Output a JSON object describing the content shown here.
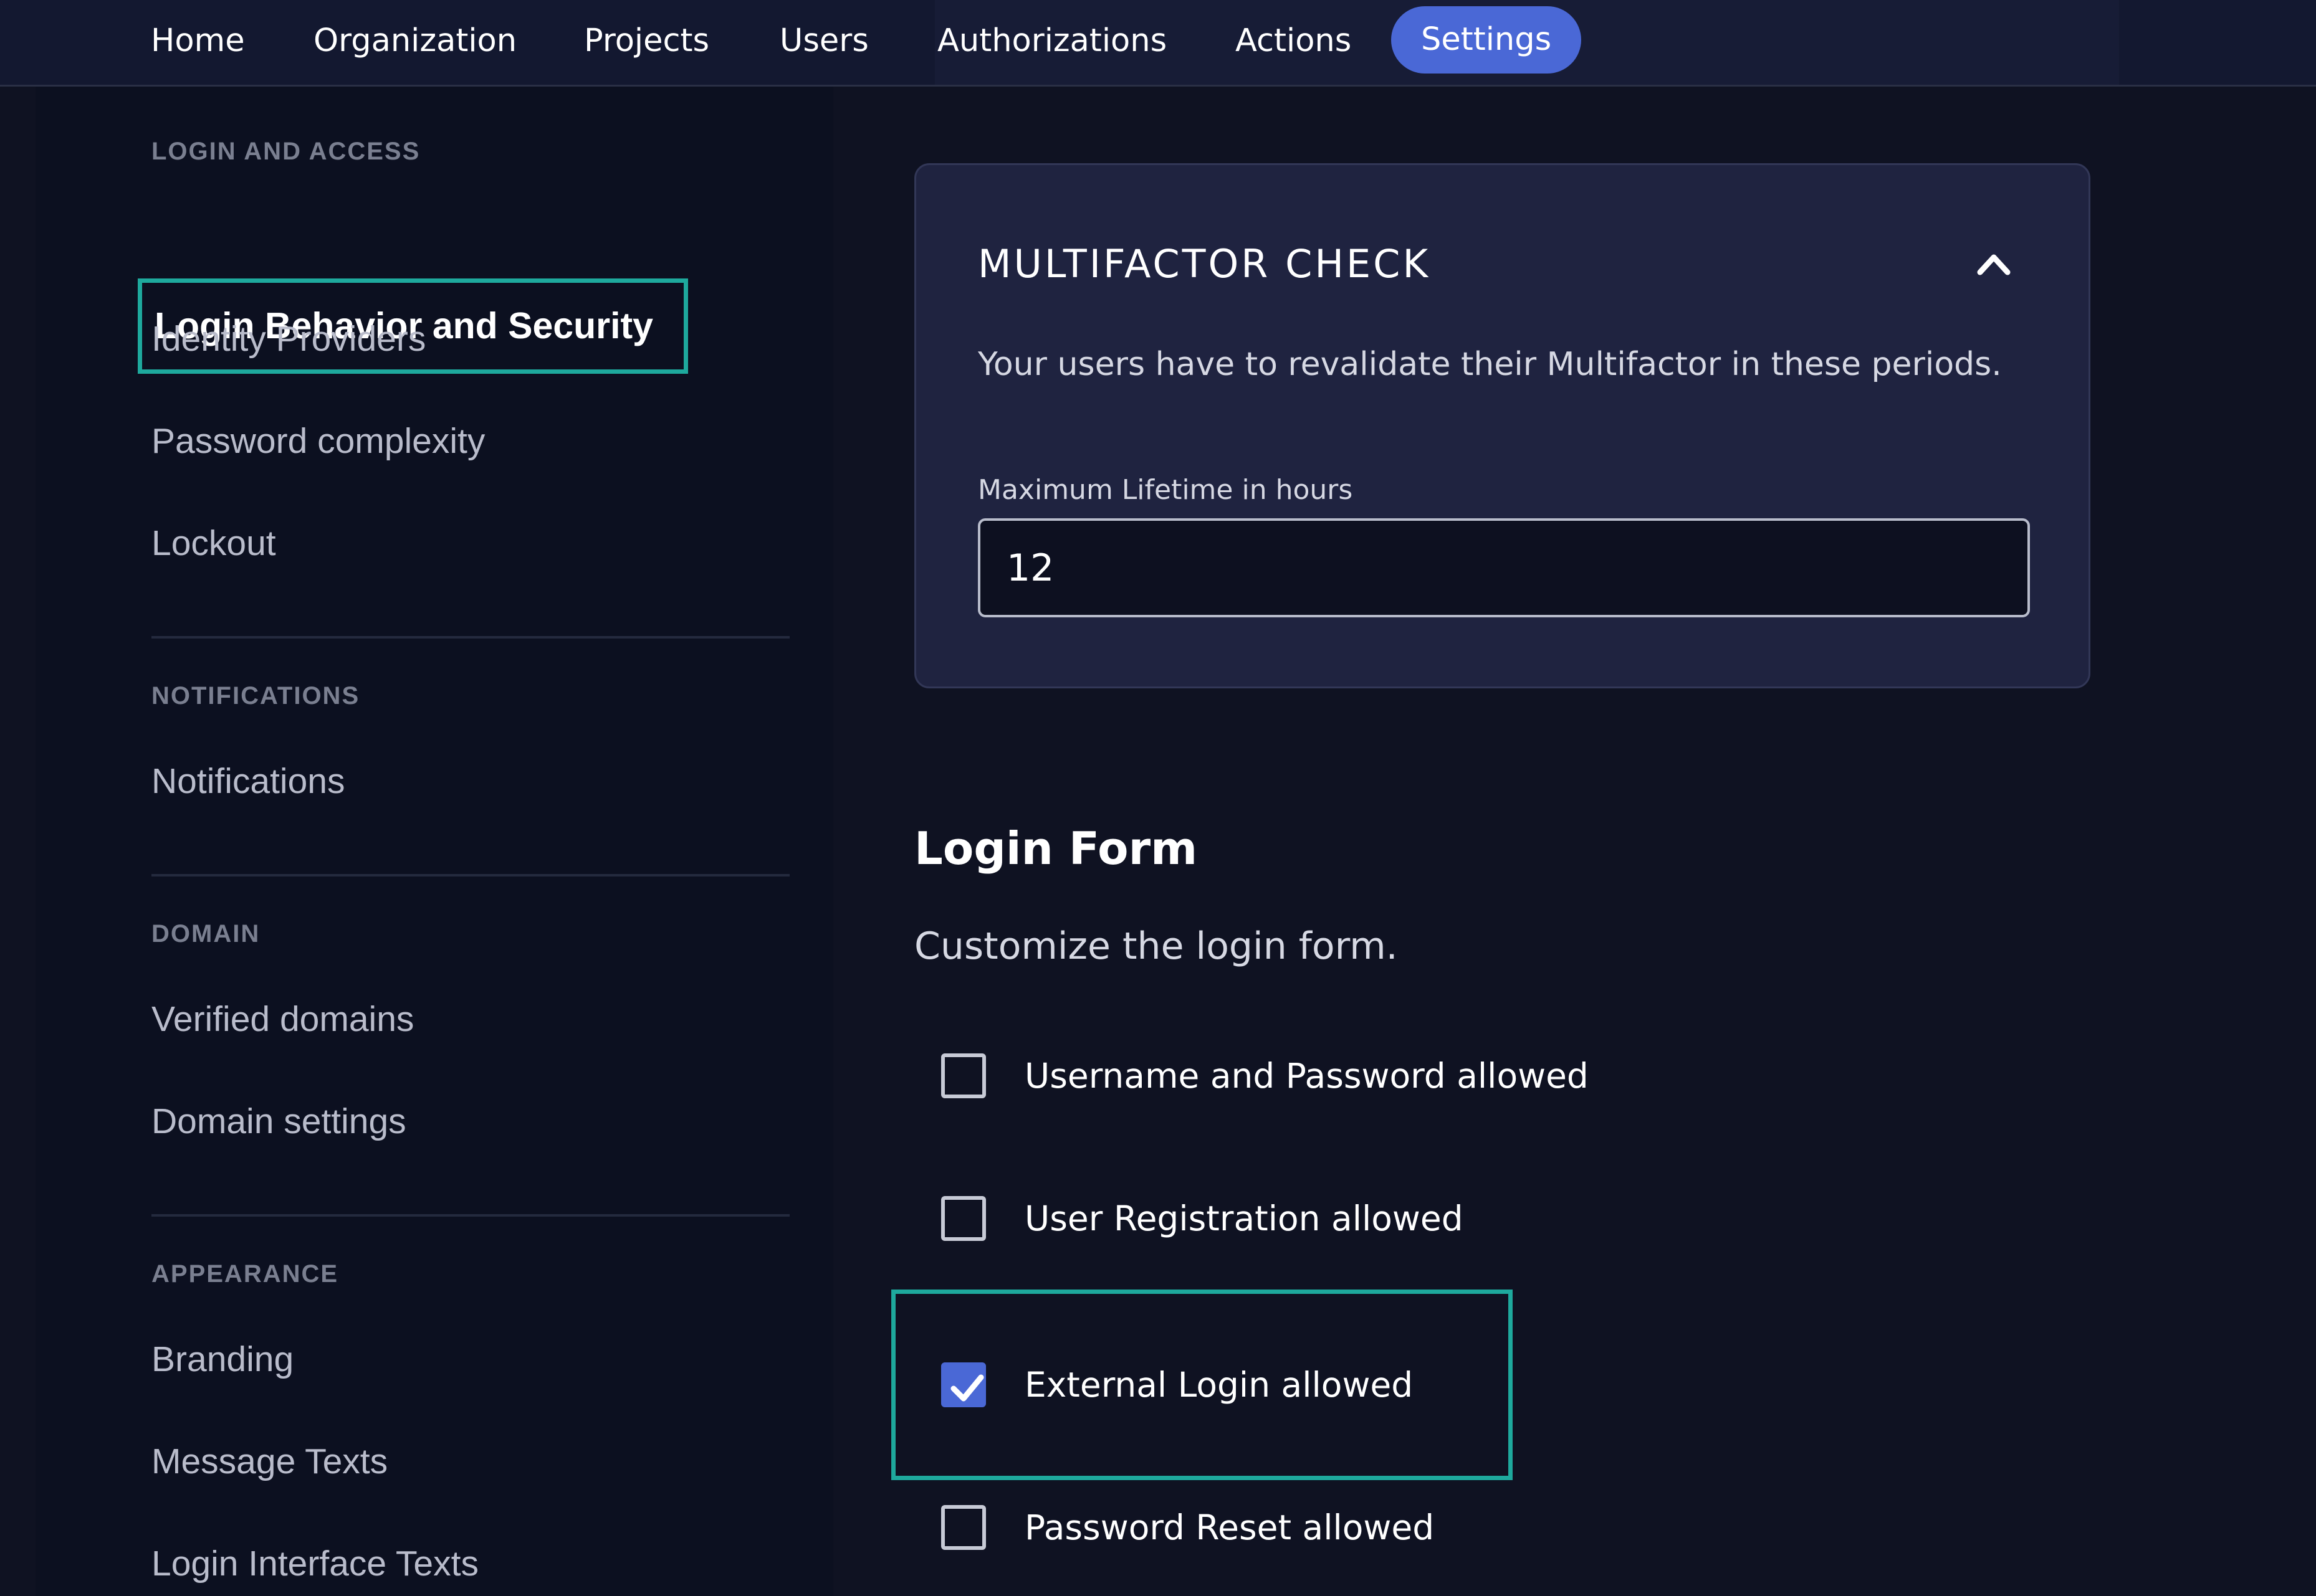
{
  "topnav": {
    "items": [
      {
        "label": "Home"
      },
      {
        "label": "Organization"
      },
      {
        "label": "Projects"
      },
      {
        "label": "Users"
      },
      {
        "label": "Authorizations"
      },
      {
        "label": "Actions"
      },
      {
        "label": "Settings",
        "active": true
      }
    ]
  },
  "sidebar": {
    "sections": [
      {
        "heading": "LOGIN AND ACCESS",
        "items": [
          "Login Behavior and Security",
          "Identity Providers",
          "Password complexity",
          "Lockout"
        ]
      },
      {
        "heading": "NOTIFICATIONS",
        "items": [
          "Notifications"
        ]
      },
      {
        "heading": "DOMAIN",
        "items": [
          "Verified domains",
          "Domain settings"
        ]
      },
      {
        "heading": "APPEARANCE",
        "items": [
          "Branding",
          "Message Texts",
          "Login Interface Texts"
        ]
      }
    ],
    "active_item": "Login Behavior and Security"
  },
  "multifactor_card": {
    "title": "MULTIFACTOR CHECK",
    "description": "Your users have to revalidate their Multifactor in these periods.",
    "field_label": "Maximum Lifetime in hours",
    "field_value": "12",
    "expanded": true
  },
  "login_form": {
    "title": "Login Form",
    "description": "Customize the login form.",
    "options": [
      {
        "label": "Username and Password allowed",
        "checked": false
      },
      {
        "label": "User Registration allowed",
        "checked": false
      },
      {
        "label": "External Login allowed",
        "checked": true
      },
      {
        "label": "Password Reset allowed",
        "checked": false
      }
    ]
  },
  "colors": {
    "accent": "#4a68d6",
    "highlight": "#1ea99d",
    "background": "#0f1222"
  }
}
